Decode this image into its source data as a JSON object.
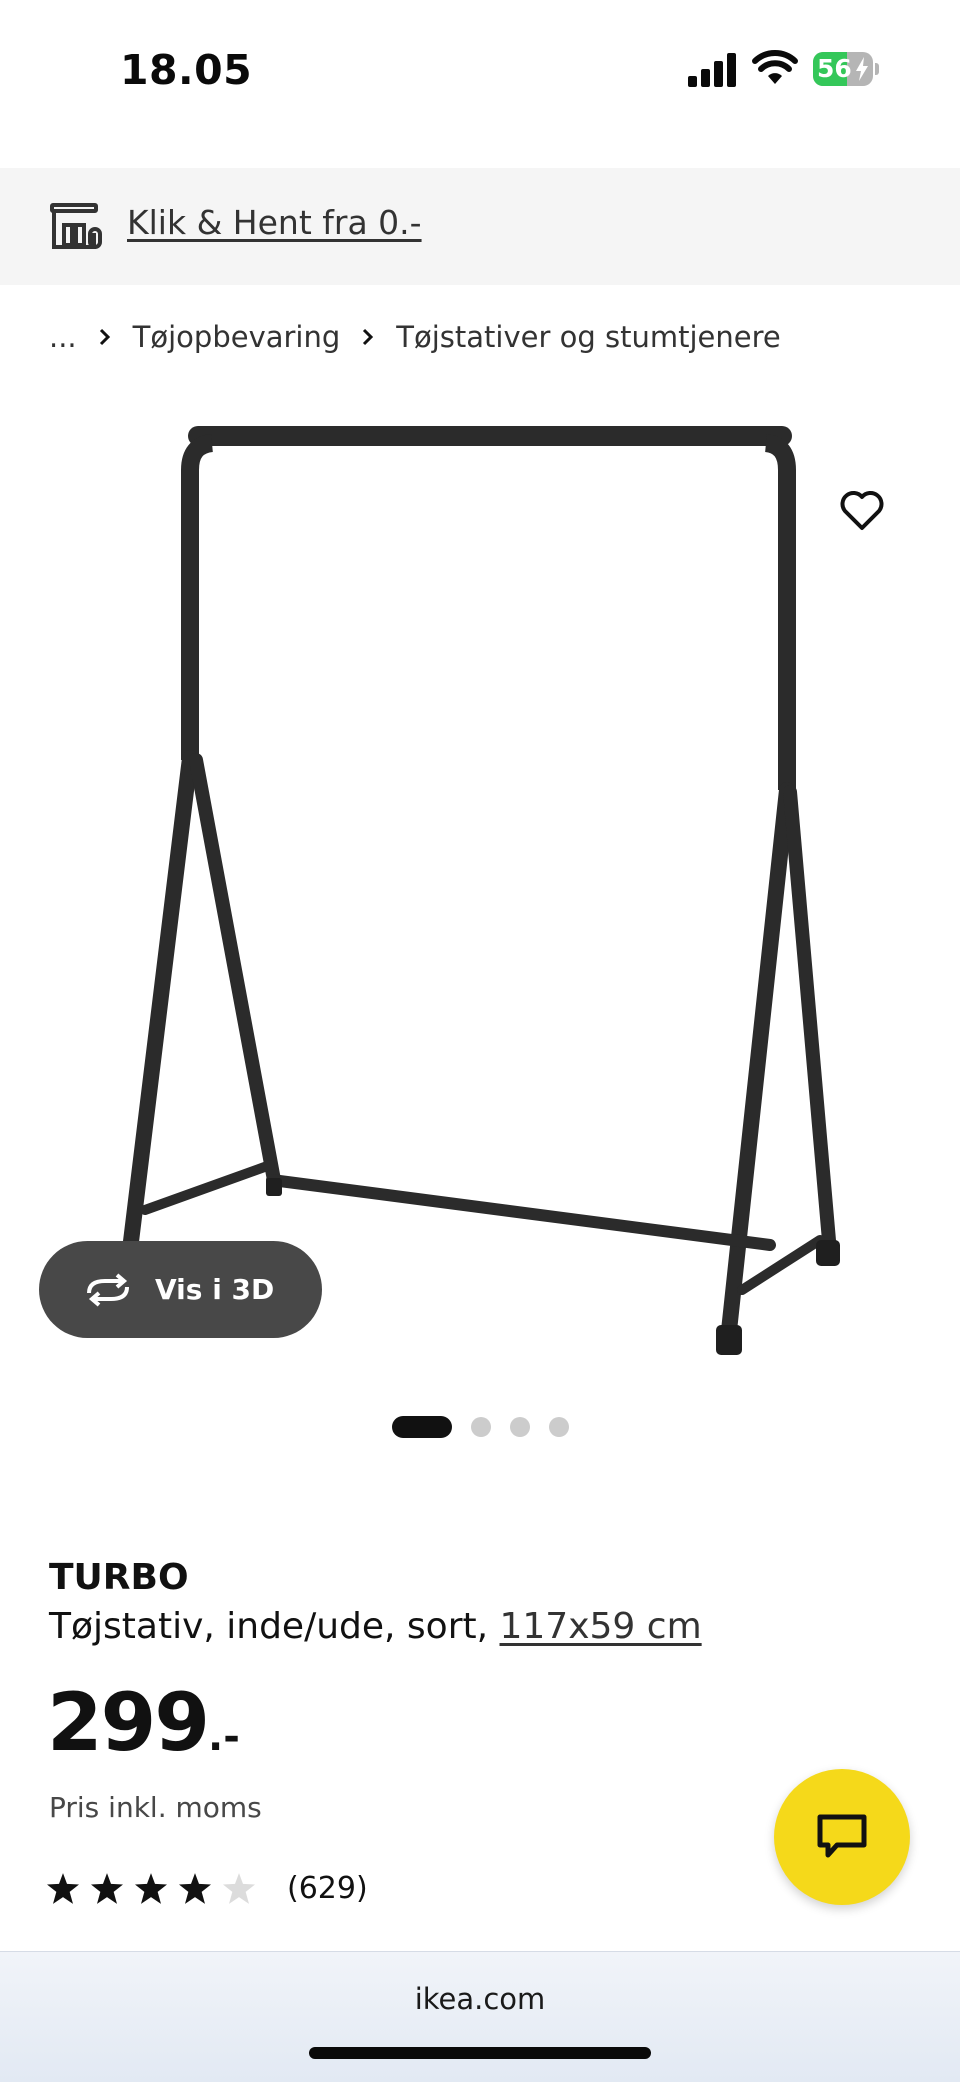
{
  "status_bar": {
    "time": "18.05",
    "battery": "56",
    "battery_level": 0.56
  },
  "promo": {
    "label": "Klik & Hent fra 0.-"
  },
  "breadcrumb": {
    "ellipsis": "...",
    "items": [
      "Tøjopbevaring",
      "Tøjstativer og stumtjenere"
    ]
  },
  "gallery": {
    "view_3d_label": "Vis i 3D",
    "image_count": 4,
    "active_index": 0
  },
  "product": {
    "name": "TURBO",
    "description": "Tøjstativ, inde/ude, sort, ",
    "size": "117x59 cm",
    "price_integer": "299",
    "price_suffix": ".-",
    "price_note": "Pris inkl. moms",
    "rating": 4,
    "rating_max": 5,
    "review_count": "(629)"
  },
  "browser": {
    "url": "ikea.com"
  },
  "colors": {
    "accent_yellow": "#f5d91a",
    "button_dark": "#484848",
    "battery_green": "#34c759"
  }
}
